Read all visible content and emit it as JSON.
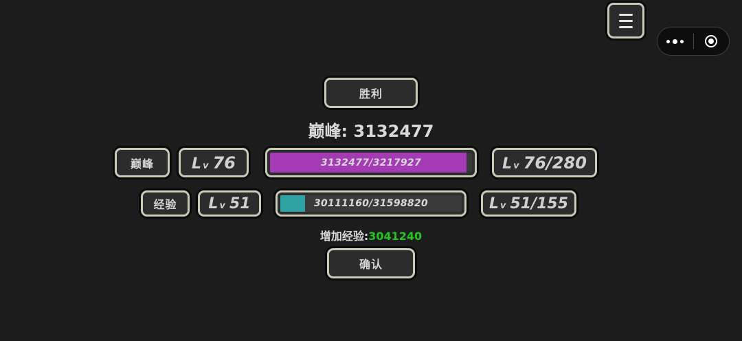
{
  "menu": {
    "icon": "menu-icon"
  },
  "capsule": {
    "more_icon": "more-dots-icon",
    "close_icon": "target-circle-icon"
  },
  "result": {
    "label": "胜利"
  },
  "peak_total": {
    "label": "巅峰:",
    "value": "3132477"
  },
  "peak_row": {
    "label": "巅峰",
    "lv_prefix": "L",
    "lv_sub": "v",
    "level": "76",
    "progress_text": "3132477/3217927",
    "progress": 0.9734,
    "cap_text": "76/280",
    "bar_color": "#a43bb5"
  },
  "exp_row": {
    "label": "经验",
    "lv_prefix": "L",
    "lv_sub": "v",
    "level": "51",
    "progress_text": "30111160/31598820",
    "progress": 0.1377,
    "cap_text": "51/155",
    "bar_color": "#2fa3a3"
  },
  "gain": {
    "label": "增加经验:",
    "value": "3041240",
    "value_color": "#22c51e"
  },
  "confirm": {
    "label": "确认"
  }
}
